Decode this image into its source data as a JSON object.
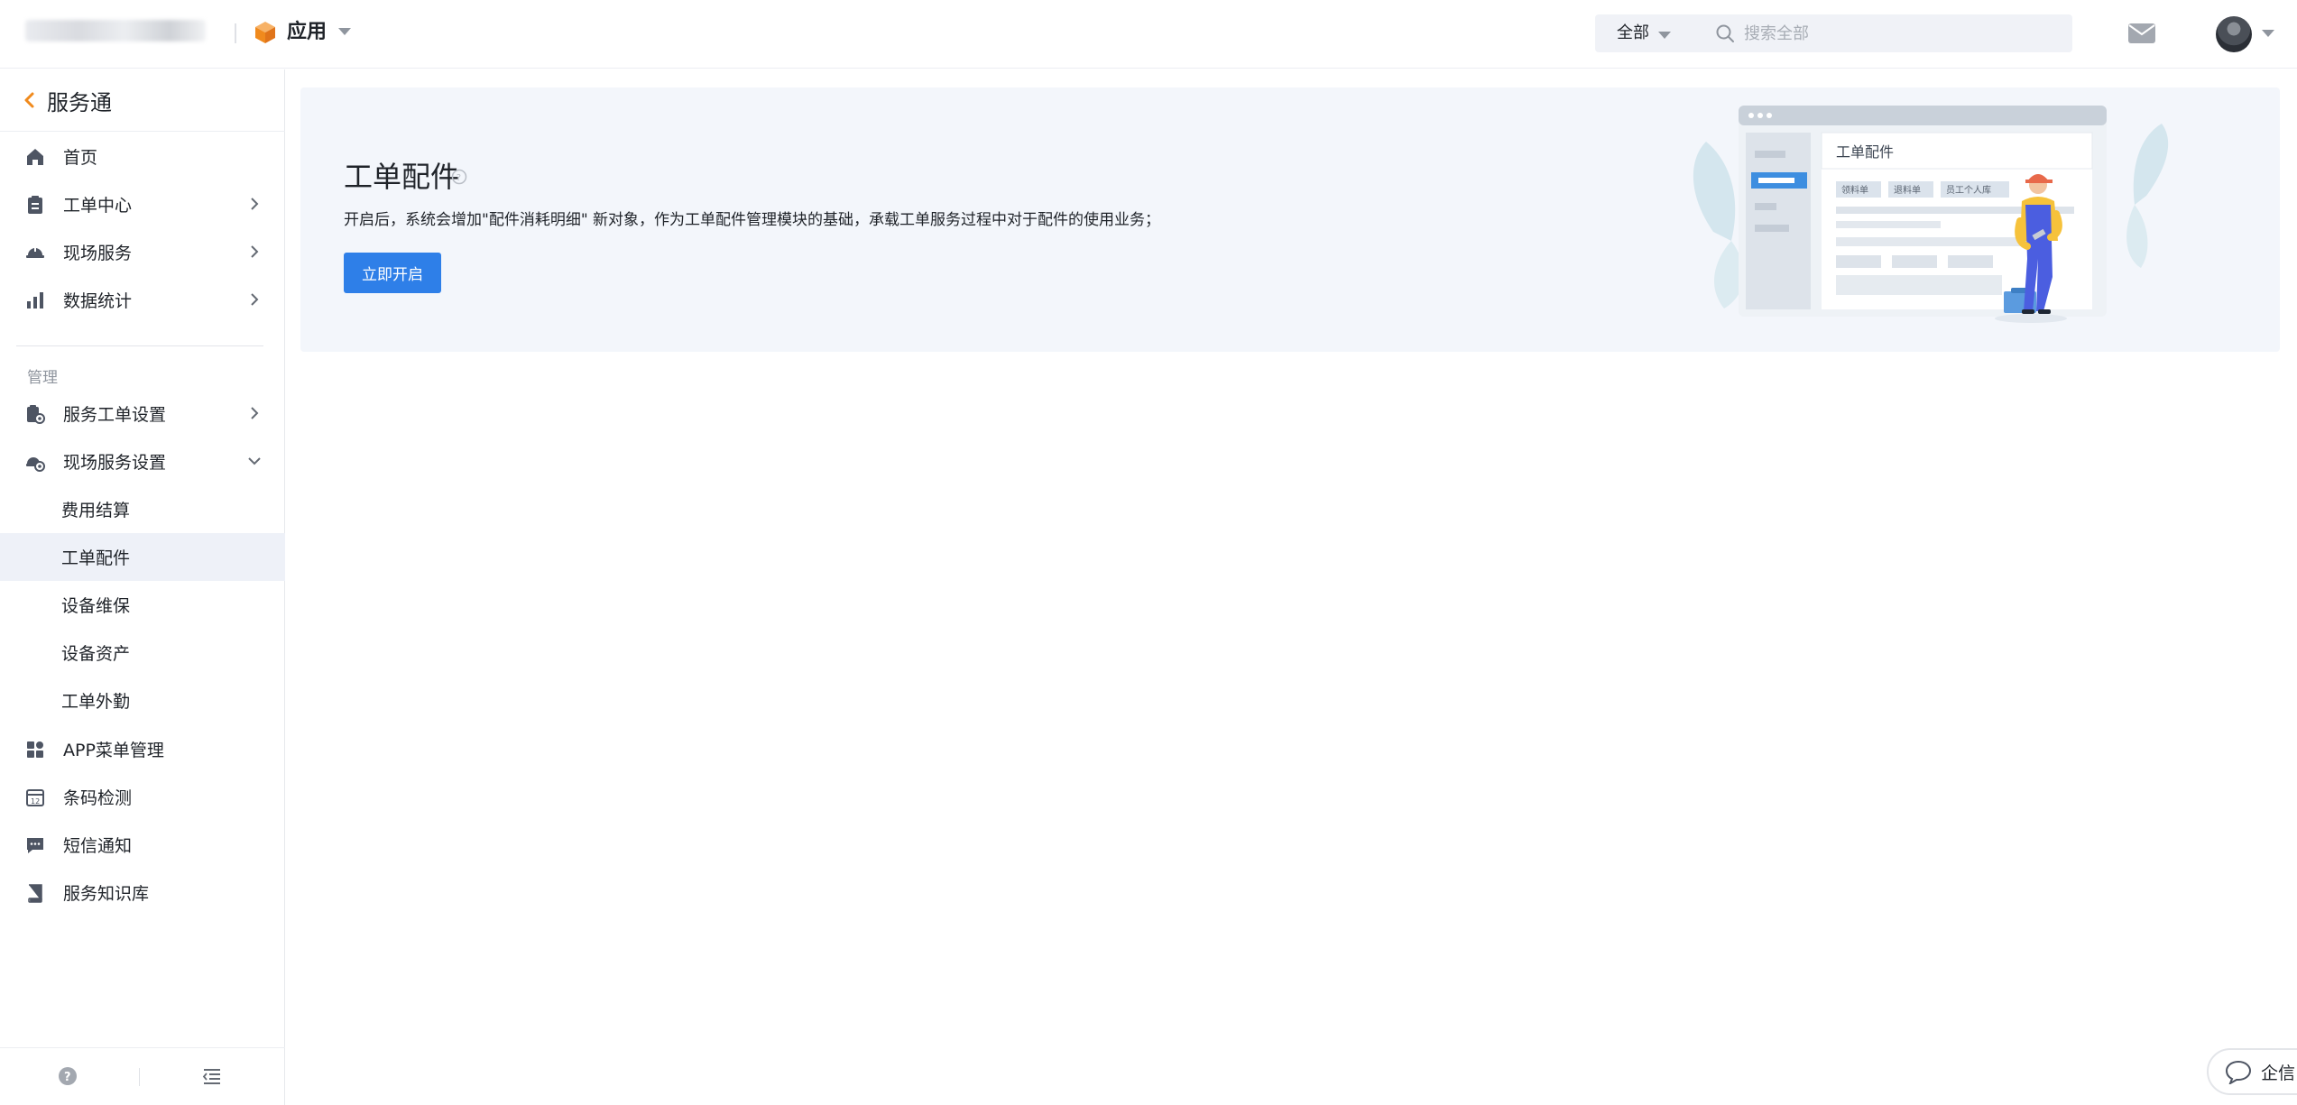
{
  "topbar": {
    "app_title": "应用",
    "search_scope": "全部",
    "search_placeholder": "搜索全部"
  },
  "sidebar": {
    "back_title": "服务通",
    "items": [
      {
        "label": "首页",
        "icon": "home-icon"
      },
      {
        "label": "工单中心",
        "icon": "clipboard-icon"
      },
      {
        "label": "现场服务",
        "icon": "helmet-icon"
      },
      {
        "label": "数据统计",
        "icon": "bar-chart-icon"
      }
    ],
    "section_label": "管理",
    "manage_items": [
      {
        "label": "服务工单设置",
        "icon": "clipboard-gear-icon"
      },
      {
        "label": "现场服务设置",
        "icon": "helmet-gear-icon"
      }
    ],
    "sub_items": [
      {
        "label": "费用结算"
      },
      {
        "label": "工单配件"
      },
      {
        "label": "设备维保"
      },
      {
        "label": "设备资产"
      },
      {
        "label": "工单外勤"
      }
    ],
    "bottom_items": [
      {
        "label": "APP菜单管理",
        "icon": "grid-icon"
      },
      {
        "label": "条码检测",
        "icon": "calendar-icon"
      },
      {
        "label": "短信通知",
        "icon": "sms-icon"
      },
      {
        "label": "服务知识库",
        "icon": "book-icon"
      }
    ]
  },
  "banner": {
    "title": "工单配件",
    "description": "开启后，系统会增加\"配件消耗明细\" 新对象，作为工单配件管理模块的基础，承载工单服务过程中对于配件的使用业务；",
    "button_label": "立即开启",
    "illustration": {
      "panel_title": "工单配件",
      "tags": [
        "领料单",
        "退料单",
        "员工个人库"
      ]
    }
  },
  "chat_widget": {
    "label": "企信"
  },
  "colors": {
    "primary": "#2e7fe8",
    "accent_orange": "#f08a1d",
    "banner_bg": "#f3f6fb",
    "active_bg": "#eef1f8"
  }
}
